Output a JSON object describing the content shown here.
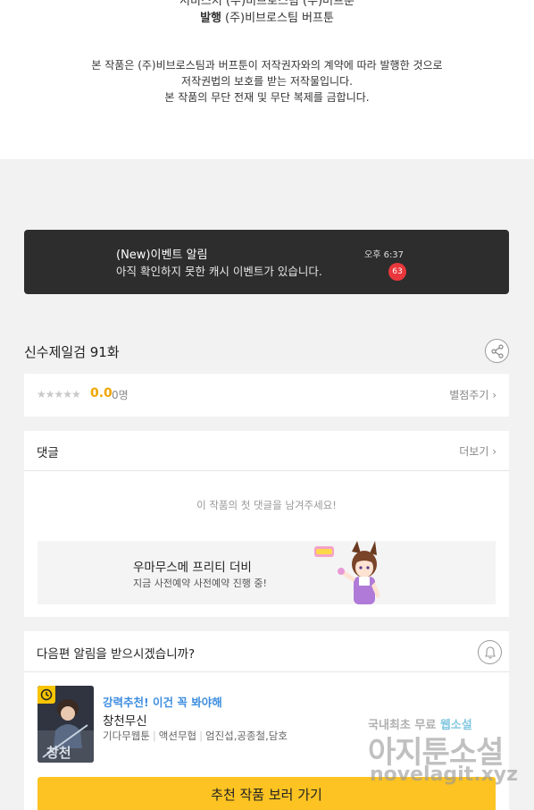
{
  "publisher": {
    "top_cut_text": "서비스처 (주)비브로스팀 (주)버프툰",
    "label": "발행",
    "value": "(주)비브로스팀  버프툰"
  },
  "copyright": {
    "line1": "본 작품은 (주)비브로스팀과 버프툰이 저작권자와의 계약에 따라 발행한 것으로",
    "line2": "저작권법의 보호를 받는 저작물입니다.",
    "line3": "본 작품의 무단 전재 및 무단 복제를 금합니다."
  },
  "notice": {
    "title": "(New)이벤트 알림",
    "body": "아직 확인하지 못한 캐시 이벤트가 있습니다.",
    "time": "오후 6:37",
    "badge": "63"
  },
  "episode": {
    "title": "신수제일검 91화"
  },
  "rating": {
    "stars": "★★★★★",
    "stars_filled": 0,
    "score": "0.0",
    "count": "0명",
    "rate_link": "별점주기 ›"
  },
  "comments": {
    "title": "댓글",
    "more": "더보기 ›",
    "empty": "이 작품의 첫 댓글을 남겨주세요!",
    "ad_title": "우마무스메 프리티 더비",
    "ad_sub": "지금 사전예약 사전예약 진행 중!"
  },
  "notify": {
    "question": "다음편 알림을 받으시겠습니까?",
    "rec_tag": "강력추천! 이건 꼭 봐야해",
    "rec_title": "창천무신",
    "rec_meta": [
      "기다무웹툰",
      "액션무협",
      "엄진섭,공종철,담호"
    ],
    "cta": "추천 작품 보러 가기"
  },
  "watermark": {
    "line1_pre": "국내최초 무료 ",
    "line1_hl": "웹소설",
    "line2": "아지툰소설",
    "line3": "novelagit.xyz"
  },
  "colors": {
    "accent_yellow": "#fcc322",
    "score_orange": "#f0a500",
    "badge_red": "#e8383d",
    "rec_blue": "#3e8ee0",
    "notice_bg": "#2d2d2d"
  },
  "icons": [
    "share-icon",
    "chevron-right-icon",
    "bell-icon",
    "clock-icon",
    "star-icon"
  ]
}
